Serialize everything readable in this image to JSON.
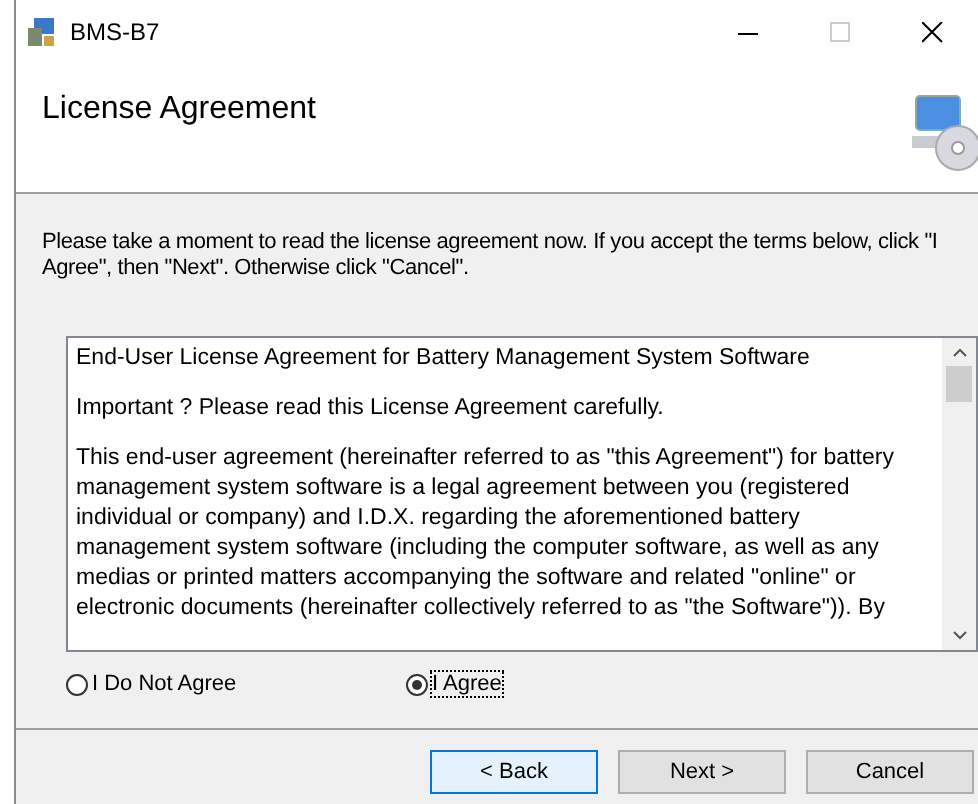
{
  "window": {
    "title": "BMS-B7"
  },
  "header": {
    "title": "License Agreement"
  },
  "instructions": "Please take a moment to read the license agreement now. If you accept the terms below, click \"I Agree\", then \"Next\". Otherwise click \"Cancel\".",
  "license_text": [
    "End-User License Agreement for Battery Management System Software",
    "Important ? Please read this License Agreement carefully.",
    "This end-user agreement (hereinafter referred to as \"this Agreement\") for battery management system software is a legal agreement between you (registered individual or company) and I.D.X. regarding the aforementioned  battery management system software (including the computer software, as well as any medias or printed matters accompanying the software and related \"online\" or electronic documents (hereinafter collectively  referred to as \"the Software\")).  By"
  ],
  "options": [
    {
      "label": "I Do Not Agree",
      "selected": false
    },
    {
      "label": "I Agree",
      "selected": true
    }
  ],
  "buttons": [
    {
      "label": "< Back",
      "default": true
    },
    {
      "label": "Next >",
      "default": false
    },
    {
      "label": "Cancel",
      "default": false
    }
  ]
}
